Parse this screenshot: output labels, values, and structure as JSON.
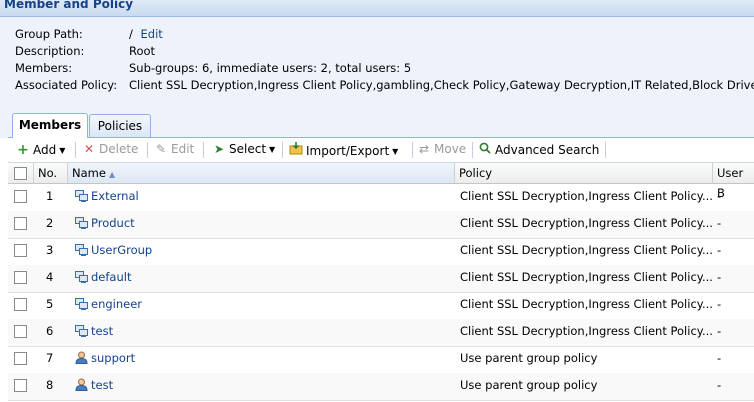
{
  "panel": {
    "title": "Member and Policy"
  },
  "info": {
    "group_path": {
      "label": "Group Path:",
      "value": "/",
      "link": "Edit"
    },
    "description": {
      "label": "Description:",
      "value": "Root"
    },
    "members": {
      "label": "Members:",
      "value": "Sub-groups: 6, immediate users: 2, total users: 5"
    },
    "policy": {
      "label": "Associated Policy:",
      "value": "Client SSL Decryption,Ingress Client Policy,gambling,Check Policy,Gateway Decryption,IT Related,Block Drive upl"
    }
  },
  "tabs": [
    {
      "label": "Members",
      "active": true
    },
    {
      "label": "Policies",
      "active": false
    }
  ],
  "toolbar": {
    "add": "Add",
    "delete": "Delete",
    "edit": "Edit",
    "select": "Select",
    "import_export": "Import/Export",
    "move": "Move",
    "advanced_search": "Advanced Search"
  },
  "columns": {
    "no": "No.",
    "name": "Name",
    "policy": "Policy",
    "user": "User B"
  },
  "rows": [
    {
      "no": "1",
      "name": "External",
      "type": "group",
      "policy": "Client SSL Decryption,Ingress Client Policy...",
      "user": "-"
    },
    {
      "no": "2",
      "name": "Product",
      "type": "group",
      "policy": "Client SSL Decryption,Ingress Client Policy...",
      "user": "-"
    },
    {
      "no": "3",
      "name": "UserGroup",
      "type": "group",
      "policy": "Client SSL Decryption,Ingress Client Policy...",
      "user": "-"
    },
    {
      "no": "4",
      "name": "default",
      "type": "group",
      "policy": "Client SSL Decryption,Ingress Client Policy...",
      "user": "-"
    },
    {
      "no": "5",
      "name": "engineer",
      "type": "group",
      "policy": "Client SSL Decryption,Ingress Client Policy...",
      "user": "-"
    },
    {
      "no": "6",
      "name": "test",
      "type": "group",
      "policy": "Client SSL Decryption,Ingress Client Policy...",
      "user": "-"
    },
    {
      "no": "7",
      "name": "support",
      "type": "user",
      "policy": "Use parent group policy",
      "user": "-"
    },
    {
      "no": "8",
      "name": "test",
      "type": "user",
      "policy": "Use parent group policy",
      "user": "-"
    }
  ],
  "colors": {
    "link": "#15428b",
    "header": "#15428b",
    "add_icon": "#2e9a2e",
    "delete_icon": "#d9534f"
  }
}
